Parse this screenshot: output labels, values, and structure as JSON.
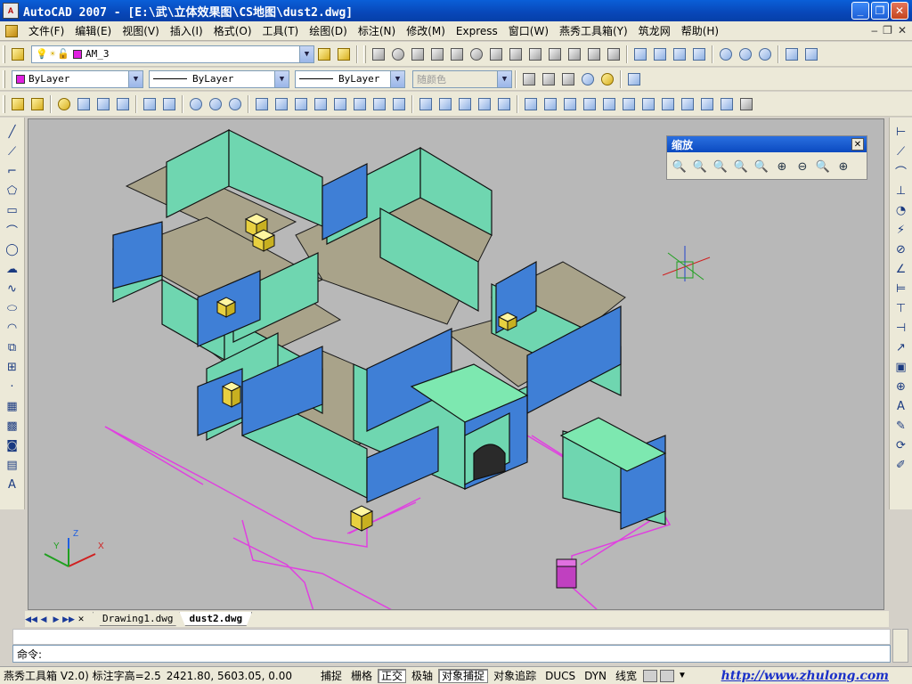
{
  "window": {
    "title": "AutoCAD 2007 - [E:\\武\\立体效果图\\CS地图\\dust2.dwg]",
    "app_icon_label": "A"
  },
  "menu": [
    "文件(F)",
    "编辑(E)",
    "视图(V)",
    "插入(I)",
    "格式(O)",
    "工具(T)",
    "绘图(D)",
    "标注(N)",
    "修改(M)",
    "Express",
    "窗口(W)",
    "燕秀工具箱(Y)",
    "筑龙网",
    "帮助(H)"
  ],
  "layers": {
    "current_layer": "AM_3",
    "layer_color": "#e020e0"
  },
  "properties": {
    "color": "ByLayer",
    "color_swatch": "#e020e0",
    "linetype": "ByLayer",
    "lineweight": "ByLayer",
    "plotstyle": "随颜色"
  },
  "zoom_panel": {
    "title": "缩放",
    "close": "✕"
  },
  "tabs": {
    "drawing1": "Drawing1.dwg",
    "dust2": "dust2.dwg"
  },
  "command": {
    "prompt": "命令:"
  },
  "status": {
    "tool_label": "燕秀工具箱 V2.0) 标注字高=2.5",
    "coordinates": "2421.80, 5603.05, 0.00",
    "toggles": [
      {
        "label": "捕捉",
        "on": false
      },
      {
        "label": "栅格",
        "on": false
      },
      {
        "label": "正交",
        "on": true
      },
      {
        "label": "极轴",
        "on": false
      },
      {
        "label": "对象捕捉",
        "on": true
      },
      {
        "label": "对象追踪",
        "on": false
      },
      {
        "label": "DUCS",
        "on": false
      },
      {
        "label": "DYN",
        "on": false
      },
      {
        "label": "线宽",
        "on": false
      }
    ],
    "link": "http://www.zhulong.com"
  },
  "ucs": {
    "x": "X",
    "y": "Y",
    "z": "Z"
  },
  "colors": {
    "wall_outer": "#3f7fd6",
    "wall_inner": "#6fd6b0",
    "floor": "#a9a38a",
    "boundary": "#e040e0",
    "box": "#f2e36b"
  }
}
